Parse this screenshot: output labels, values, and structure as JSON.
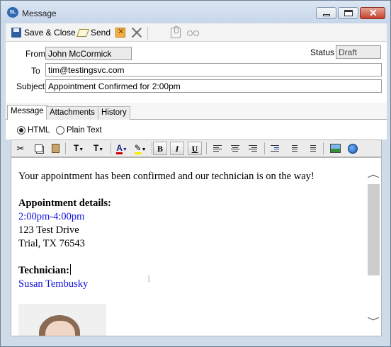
{
  "window": {
    "title": "Message",
    "app_icon_text": "SL",
    "controls": {
      "minimize": "minimize",
      "maximize": "maximize",
      "close": "✕"
    }
  },
  "toolbar": {
    "save_close_label": "Save & Close",
    "send_label": "Send",
    "icons": [
      "save-icon",
      "send-icon",
      "delete-icon",
      "close-x-icon",
      "attach-icon",
      "preview-icon"
    ]
  },
  "fields": {
    "from_label": "From",
    "from_value": "John McCormick",
    "status_label": "Status",
    "status_value": "Draft",
    "to_label": "To",
    "to_value": "tim@testingsvc.com",
    "subject_label": "Subject",
    "subject_value": "Appointment Confirmed for 2:00pm"
  },
  "tabs": [
    "Message",
    "Attachments",
    "History"
  ],
  "active_tab": "Message",
  "format": {
    "html_label": "HTML",
    "plain_label": "Plain Text",
    "selected": "HTML"
  },
  "editor_toolbar": {
    "bold": "B",
    "italic": "I",
    "underline": "U",
    "font_size": "T",
    "font_style": "T",
    "font_color": "A"
  },
  "message": {
    "intro": "Your appointment has been confirmed and our technician is on the way!",
    "details_heading": "Appointment details:",
    "time": "2:00pm-4:00pm",
    "address_line1": "123 Test Drive",
    "address_line2": "Trial, TX 76543",
    "technician_heading": "Technician:",
    "technician_name": "Susan Tembusky"
  },
  "colors": {
    "link_blue": "#1010e0",
    "window_frame": "#cfdbe9",
    "close_button": "#c6402a"
  }
}
